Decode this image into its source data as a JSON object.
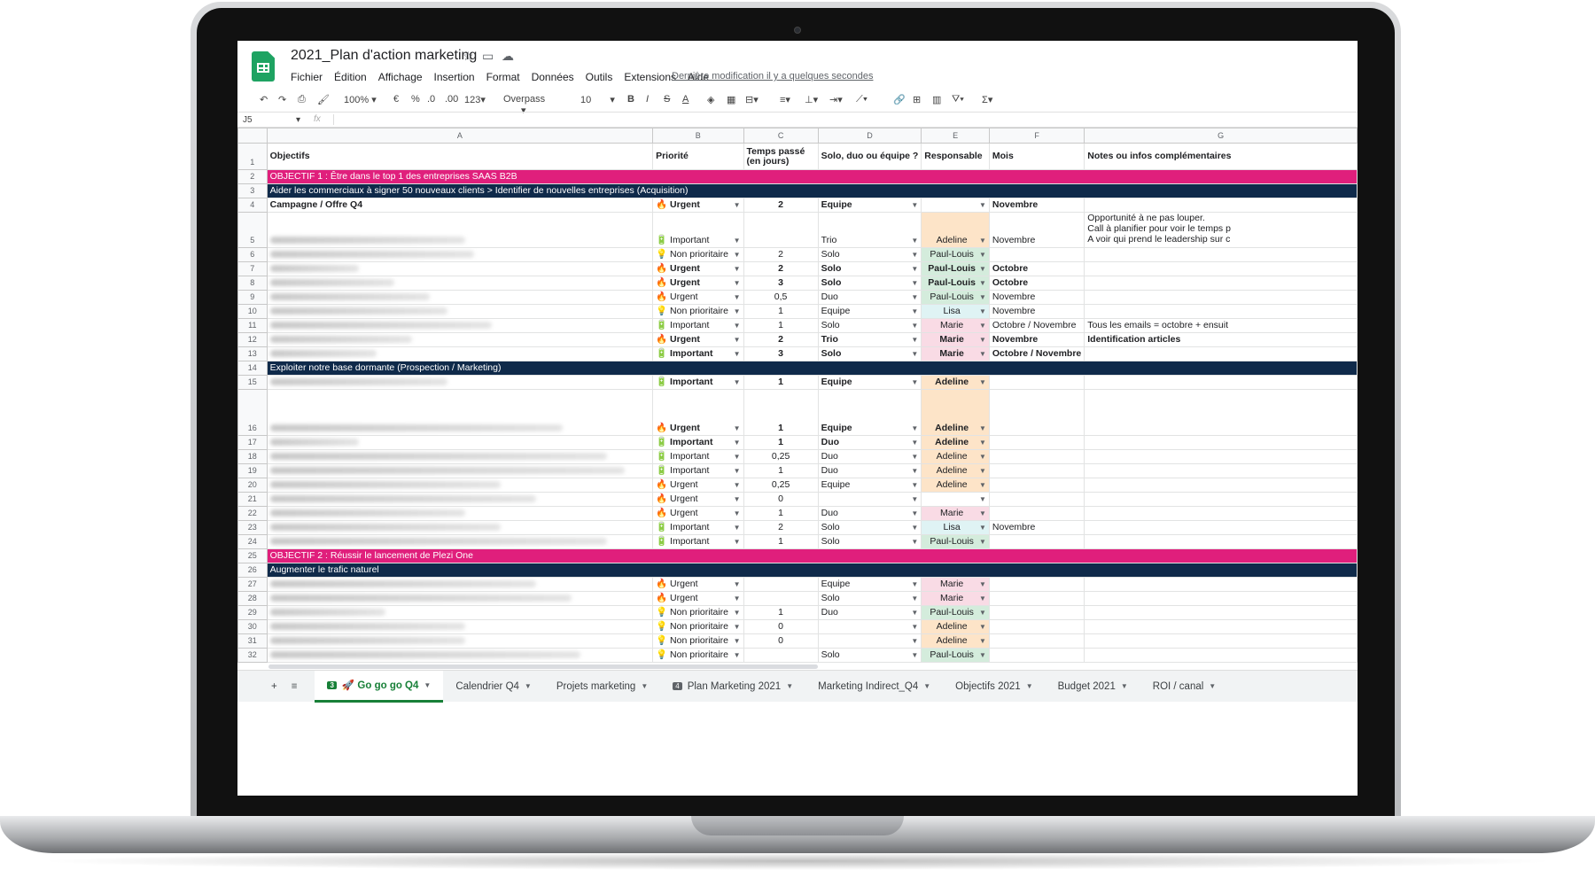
{
  "doc": {
    "title": "2021_Plan d'action marketing",
    "last_modified": "Dernière modification il y a quelques secondes",
    "menu": [
      "Fichier",
      "Édition",
      "Affichage",
      "Insertion",
      "Format",
      "Données",
      "Outils",
      "Extensions",
      "Aide"
    ]
  },
  "toolbar": {
    "zoom": "100%",
    "currency": "€",
    "percent": "%",
    "dec_less": ".0",
    "dec_more": ".00",
    "format": "123",
    "font": "Overpass",
    "size": "10",
    "bold": "B",
    "italic": "I",
    "strike": "S",
    "text_color": "A",
    "function_symbol": "Σ"
  },
  "formula_bar": {
    "cell_ref": "J5",
    "fx": "fx"
  },
  "columns": [
    "A",
    "B",
    "C",
    "D",
    "E",
    "F",
    "G"
  ],
  "header_row": {
    "a": "Objectifs",
    "b": "Priorité",
    "c": "Temps passé (en jours)",
    "d": "Solo, duo ou équipe ?",
    "e": "Responsable",
    "f": "Mois",
    "g": "Notes ou infos complémentaires"
  },
  "rows": [
    {
      "n": "2",
      "type": "obj",
      "a": "OBJECTIF 1 :  Être dans le top 1 des entreprises SAAS B2B"
    },
    {
      "n": "3",
      "type": "sub",
      "a": "Aider les commerciaux à signer 50 nouveaux clients  > Identifier de nouvelles entreprises (Acquisition)"
    },
    {
      "n": "4",
      "type": "data",
      "a": "Campagne / Offre Q4",
      "b": "🔥 Urgent",
      "c": "2",
      "d": "Equipe",
      "e": "",
      "ec": "none",
      "f": "Novembre",
      "g": "",
      "bold": true
    },
    {
      "n": "5",
      "type": "data",
      "tall": true,
      "blur": 220,
      "b": "🔋 Important",
      "c": "",
      "d": "Trio",
      "e": "Adeline",
      "ec": "orange",
      "f": "Novembre",
      "g": "Opportunité à ne pas louper.\nCall à planifier pour voir le temps p\nA voir qui prend le leadership sur c"
    },
    {
      "n": "6",
      "type": "data",
      "blur": 230,
      "b": "💡 Non prioritaire",
      "c": "2",
      "d": "Solo",
      "e": "Paul-Louis",
      "ec": "green",
      "f": "",
      "g": ""
    },
    {
      "n": "7",
      "type": "data",
      "blur": 100,
      "b": "🔥 Urgent",
      "c": "2",
      "d": "Solo",
      "e": "Paul-Louis",
      "ec": "green",
      "f": "Octobre",
      "g": "",
      "bold": true
    },
    {
      "n": "8",
      "type": "data",
      "blur": 140,
      "b": "🔥 Urgent",
      "c": "3",
      "d": "Solo",
      "e": "Paul-Louis",
      "ec": "green",
      "f": "Octobre",
      "g": "",
      "bold": true
    },
    {
      "n": "9",
      "type": "data",
      "blur": 180,
      "b": "🔥 Urgent",
      "c": "0,5",
      "d": "Duo",
      "e": "Paul-Louis",
      "ec": "green",
      "f": "Novembre",
      "g": ""
    },
    {
      "n": "10",
      "type": "data",
      "blur": 200,
      "b": "💡 Non prioritaire",
      "c": "1",
      "d": "Equipe",
      "e": "Lisa",
      "ec": "blue",
      "f": "Novembre",
      "g": ""
    },
    {
      "n": "11",
      "type": "data",
      "blur": 250,
      "b": "🔋 Important",
      "c": "1",
      "d": "Solo",
      "e": "Marie",
      "ec": "pink",
      "f": "Octobre / Novembre",
      "g": "Tous les emails = octobre  + ensuit"
    },
    {
      "n": "12",
      "type": "data",
      "blur": 160,
      "b": "🔥 Urgent",
      "c": "2",
      "d": "Trio",
      "e": "Marie",
      "ec": "pink",
      "f": "Novembre",
      "g": "Identification articles",
      "bold": true
    },
    {
      "n": "13",
      "type": "data",
      "blur": 120,
      "b": "🔋 Important",
      "c": "3",
      "d": "Solo",
      "e": "Marie",
      "ec": "pink",
      "f": "Octobre / Novembre",
      "g": "",
      "bold": true
    },
    {
      "n": "14",
      "type": "sub",
      "a": "Exploiter notre base dormante (Prospection / Marketing)"
    },
    {
      "n": "15",
      "type": "data",
      "blur": 200,
      "b": "🔋 Important",
      "c": "1",
      "d": "Equipe",
      "e": "Adeline",
      "ec": "orange",
      "f": "",
      "g": "",
      "bold": true
    },
    {
      "n": "16",
      "type": "data",
      "tall2": true,
      "blur": 330,
      "b": "🔥 Urgent",
      "c": "1",
      "d": "Equipe",
      "e": "Adeline",
      "ec": "orange",
      "f": "",
      "g": "",
      "bold": true
    },
    {
      "n": "17",
      "type": "data",
      "blur": 100,
      "b": "🔋 Important",
      "c": "1",
      "d": "Duo",
      "e": "Adeline",
      "ec": "orange",
      "f": "",
      "g": "",
      "bold": true
    },
    {
      "n": "18",
      "type": "data",
      "blur": 380,
      "b": "🔋 Important",
      "c": "0,25",
      "d": "Duo",
      "e": "Adeline",
      "ec": "orange",
      "f": "",
      "g": ""
    },
    {
      "n": "19",
      "type": "data",
      "blur": 400,
      "b": "🔋 Important",
      "c": "1",
      "d": "Duo",
      "e": "Adeline",
      "ec": "orange",
      "f": "",
      "g": ""
    },
    {
      "n": "20",
      "type": "data",
      "blur": 260,
      "b": "🔥 Urgent",
      "c": "0,25",
      "d": "Equipe",
      "e": "Adeline",
      "ec": "orange",
      "f": "",
      "g": ""
    },
    {
      "n": "21",
      "type": "data",
      "blur": 300,
      "b": "🔥 Urgent",
      "c": "0",
      "d": "",
      "e": "",
      "ec": "none",
      "f": "",
      "g": ""
    },
    {
      "n": "22",
      "type": "data",
      "blur": 220,
      "b": "🔥 Urgent",
      "c": "1",
      "d": "Duo",
      "e": "Marie",
      "ec": "pink",
      "f": "",
      "g": ""
    },
    {
      "n": "23",
      "type": "data",
      "blur": 260,
      "b": "🔋 Important",
      "c": "2",
      "d": "Solo",
      "e": "Lisa",
      "ec": "blue",
      "f": "Novembre",
      "g": ""
    },
    {
      "n": "24",
      "type": "data",
      "blur": 380,
      "b": "🔋 Important",
      "c": "1",
      "d": "Solo",
      "e": "Paul-Louis",
      "ec": "green",
      "f": "",
      "g": ""
    },
    {
      "n": "25",
      "type": "obj",
      "a": "OBJECTIF 2 :  Réussir le lancement de Plezi One"
    },
    {
      "n": "26",
      "type": "sub",
      "a": "Augmenter le trafic naturel"
    },
    {
      "n": "27",
      "type": "data",
      "blur": 300,
      "b": "🔥 Urgent",
      "c": "",
      "d": "Equipe",
      "e": "Marie",
      "ec": "pink",
      "f": "",
      "g": ""
    },
    {
      "n": "28",
      "type": "data",
      "blur": 340,
      "b": "🔥 Urgent",
      "c": "",
      "d": "Solo",
      "e": "Marie",
      "ec": "pink",
      "f": "",
      "g": ""
    },
    {
      "n": "29",
      "type": "data",
      "blur": 130,
      "b": "💡 Non prioritaire",
      "c": "1",
      "d": "Duo",
      "e": "Paul-Louis",
      "ec": "green",
      "f": "",
      "g": ""
    },
    {
      "n": "30",
      "type": "data",
      "blur": 220,
      "b": "💡 Non prioritaire",
      "c": "0",
      "d": "",
      "e": "Adeline",
      "ec": "orange",
      "f": "",
      "g": ""
    },
    {
      "n": "31",
      "type": "data",
      "blur": 220,
      "b": "💡 Non prioritaire",
      "c": "0",
      "d": "",
      "e": "Adeline",
      "ec": "orange",
      "f": "",
      "g": ""
    },
    {
      "n": "32",
      "type": "data",
      "blur": 350,
      "b": "💡 Non prioritaire",
      "c": "",
      "d": "Solo",
      "e": "Paul-Louis",
      "ec": "green",
      "f": "",
      "g": ""
    }
  ],
  "tabs": [
    {
      "label": "🚀 Go go go Q4",
      "badge": "3",
      "active": true
    },
    {
      "label": "Calendrier Q4"
    },
    {
      "label": "Projets marketing"
    },
    {
      "label": "Plan Marketing 2021",
      "badge": "4"
    },
    {
      "label": "Marketing Indirect_Q4"
    },
    {
      "label": "Objectifs 2021"
    },
    {
      "label": "Budget 2021"
    },
    {
      "label": "ROI / canal"
    }
  ],
  "colors": {
    "objective": "#e01f7c",
    "subheader": "#0f2a4a",
    "active_tab": "#188038",
    "adeline": "#fde4c8",
    "paul_louis": "#d4ecdc",
    "marie": "#f9dbe5",
    "lisa": "#dff3f4"
  }
}
